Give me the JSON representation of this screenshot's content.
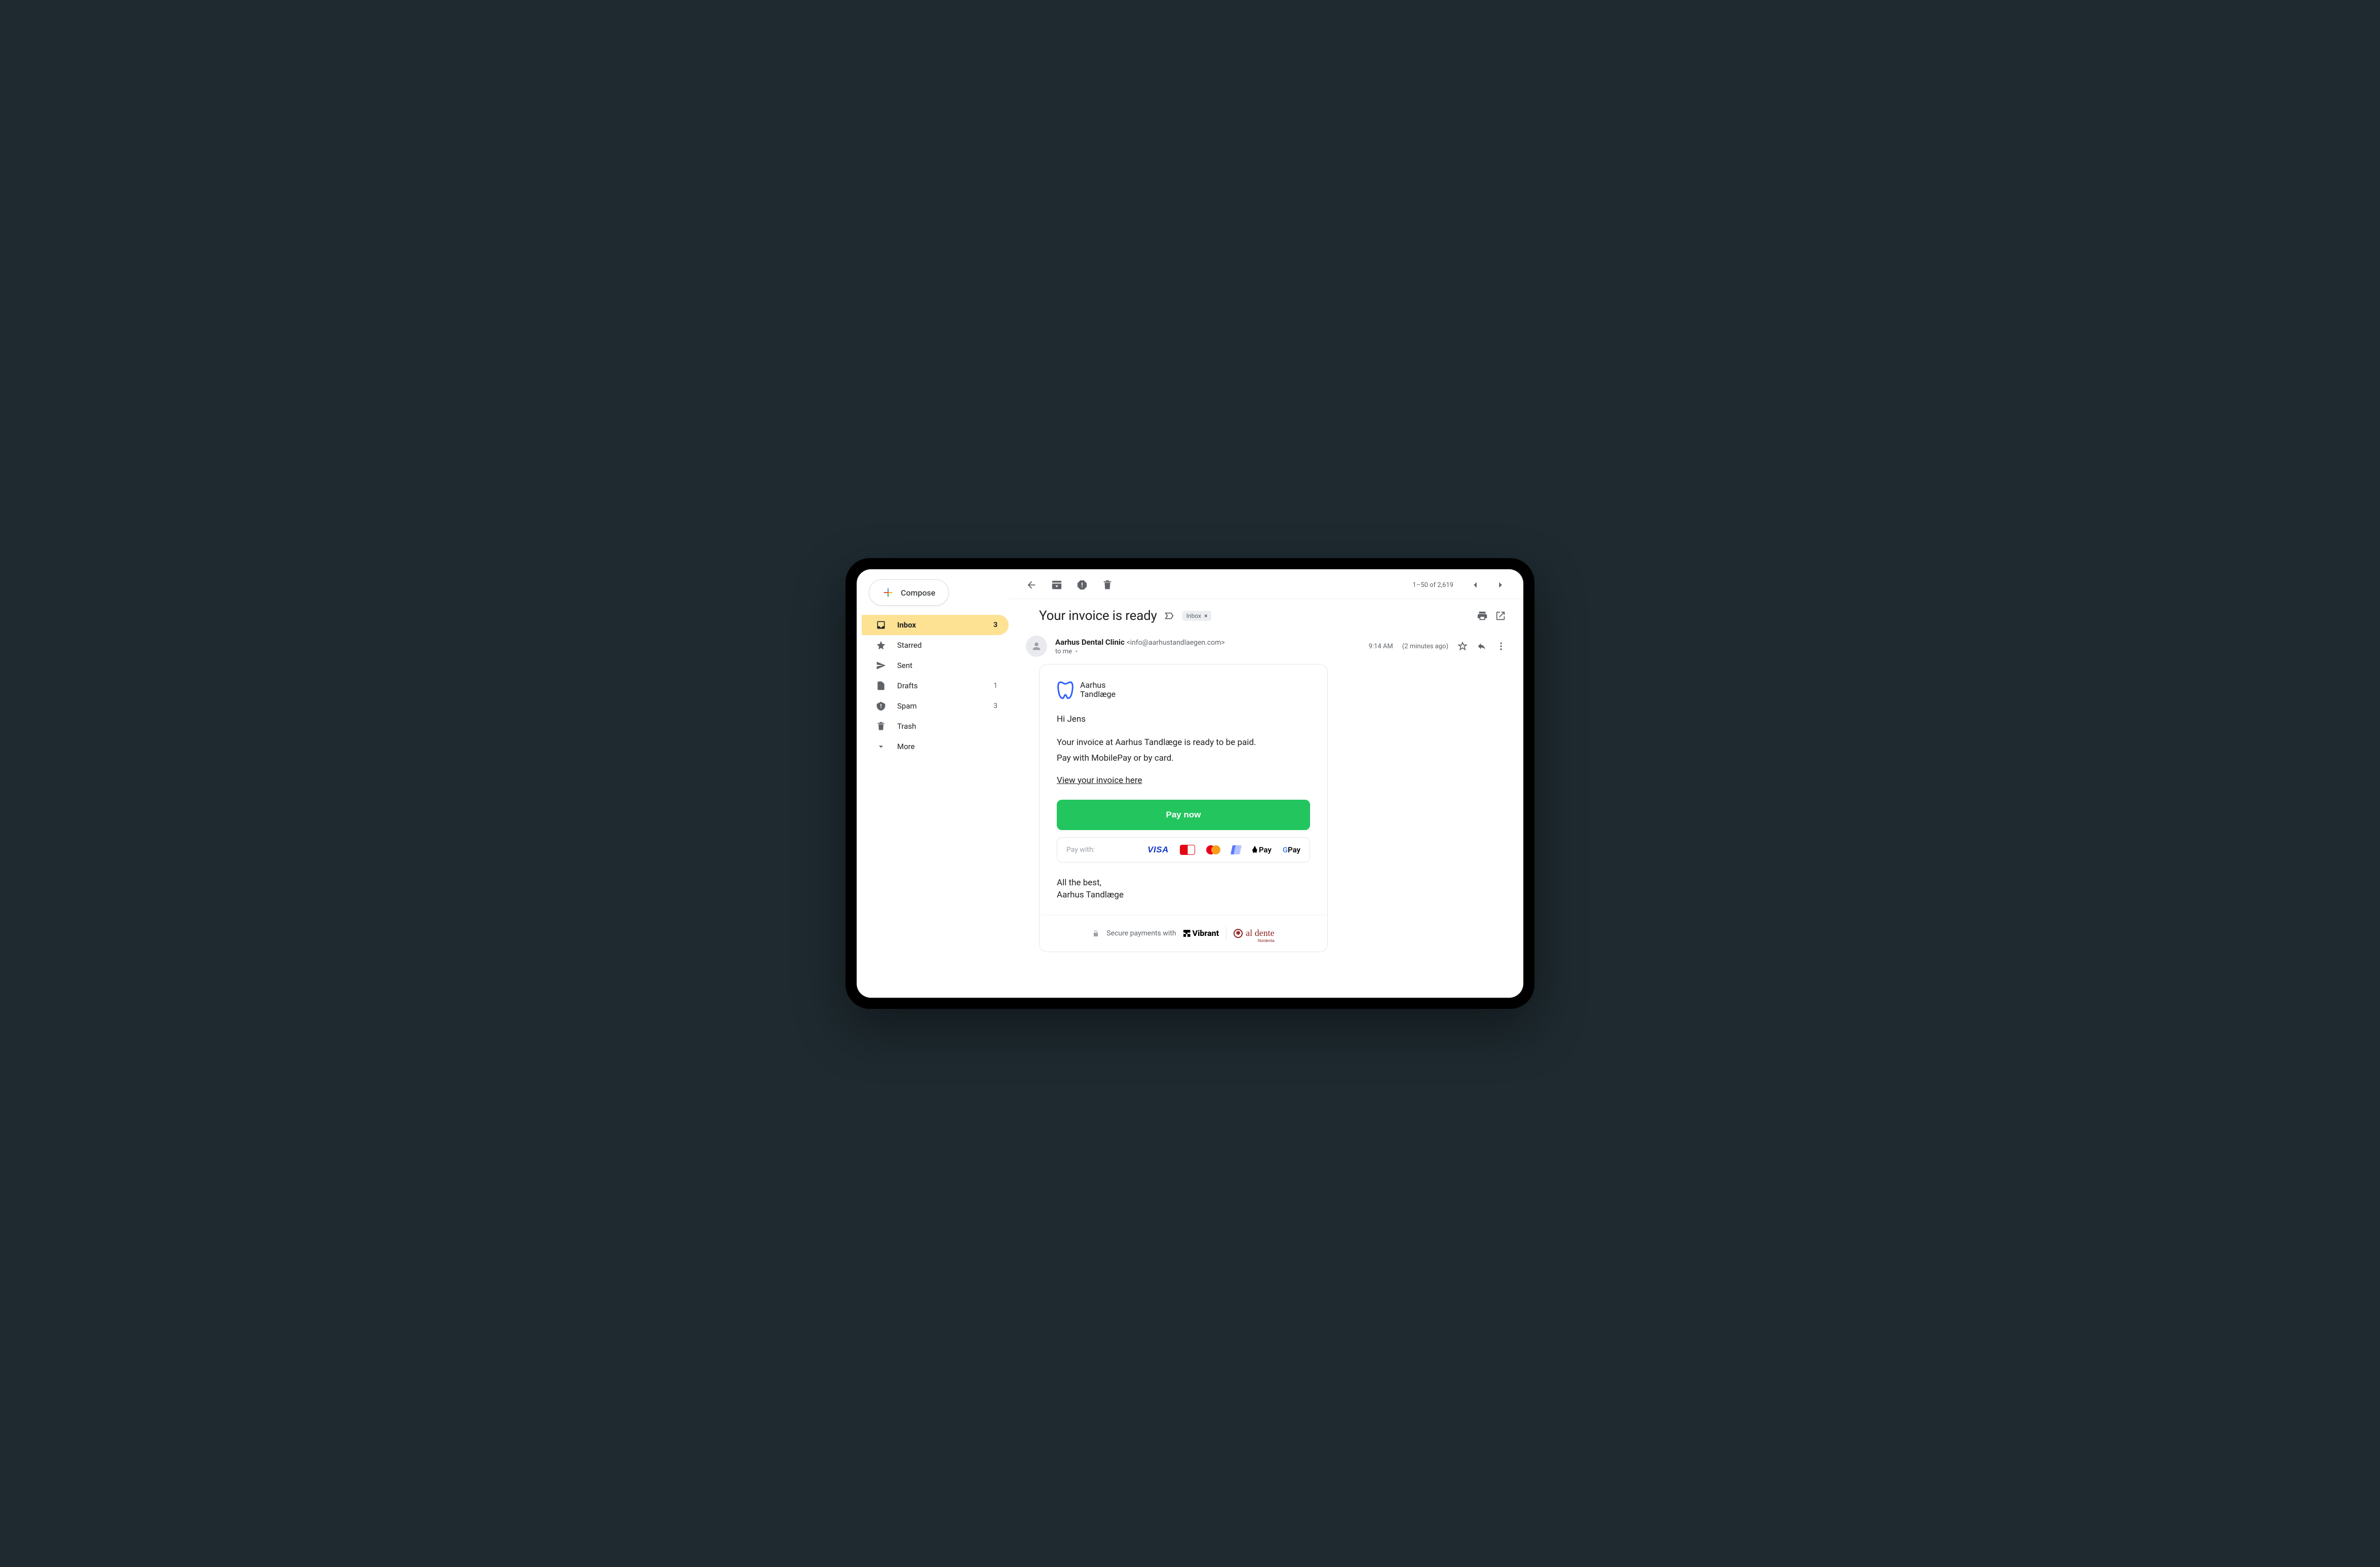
{
  "compose_label": "Compose",
  "sidebar": {
    "items": [
      {
        "label": "Inbox",
        "count": "3",
        "active": true
      },
      {
        "label": "Starred",
        "count": "",
        "active": false
      },
      {
        "label": "Sent",
        "count": "",
        "active": false
      },
      {
        "label": "Drafts",
        "count": "1",
        "active": false
      },
      {
        "label": "Spam",
        "count": "3",
        "active": false
      },
      {
        "label": "Trash",
        "count": "",
        "active": false
      },
      {
        "label": "More",
        "count": "",
        "active": false
      }
    ]
  },
  "toolbar": {
    "range": "1–50 of 2,619"
  },
  "message": {
    "subject": "Your invoice is ready",
    "chip_label": "Inbox",
    "from_name": "Aarhus Dental Clinic",
    "from_email": "<info@aarhustandlaegen.com>",
    "to_label": "to me",
    "time": "9:14 AM",
    "relative": "(2 minutes ago)"
  },
  "email": {
    "brand_line1": "Aarhus",
    "brand_line2": "Tandlæge",
    "greeting": "Hi Jens",
    "body_line1": "Your invoice at Aarhus Tandlæge is ready to be paid.",
    "body_line2": "Pay with MobilePay or by card.",
    "link_text": "View your invoice here",
    "cta": "Pay now",
    "pay_with_label": "Pay with:",
    "payment_methods": [
      "visa",
      "dankort",
      "mastercard",
      "mobilepay",
      "apple-pay",
      "google-pay"
    ],
    "closing_line1": "All the best,",
    "closing_line2": "Aarhus Tandlæge",
    "footer_text": "Secure payments with",
    "footer_brand1": "Vibrant",
    "footer_brand2": "al dente",
    "footer_brand2_sub": "Nordenta"
  }
}
